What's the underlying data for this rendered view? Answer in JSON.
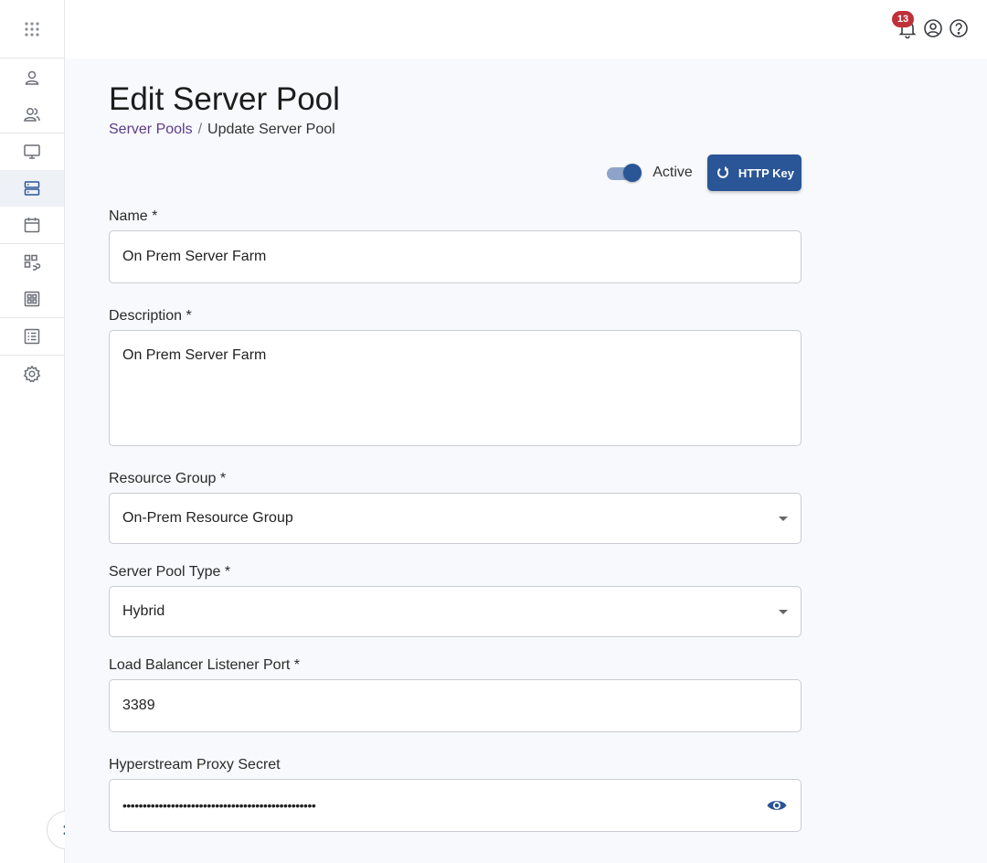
{
  "topbar": {
    "notification_count": "13"
  },
  "page": {
    "title": "Edit Server Pool",
    "breadcrumb": {
      "parent": "Server Pools",
      "separator": "/",
      "current": "Update Server Pool"
    }
  },
  "actions": {
    "toggle_label": "Active",
    "toggle_on": true,
    "http_key_label": "HTTP Key"
  },
  "form": {
    "name": {
      "label": "Name *",
      "value": "On Prem Server Farm"
    },
    "description": {
      "label": "Description *",
      "value": "On Prem Server Farm"
    },
    "resource_group": {
      "label": "Resource Group *",
      "value": "On-Prem Resource Group"
    },
    "server_pool_type": {
      "label": "Server Pool Type *",
      "value": "Hybrid"
    },
    "listener_port": {
      "label": "Load Balancer Listener Port *",
      "value": "3389"
    },
    "proxy_secret": {
      "label": "Hyperstream Proxy Secret",
      "value": "••••••••••••••••••••••••••••••••••••••••••••••••"
    }
  },
  "sidebar": {
    "icons": [
      "apps-grid-icon",
      "user-icon",
      "users-icon",
      "monitor-icon",
      "server-icon",
      "calendar-icon",
      "app-link-icon",
      "dashboard-icon",
      "list-icon",
      "gear-icon"
    ],
    "active": "server-icon"
  },
  "colors": {
    "primary": "#2a5596",
    "badge": "#c0303a",
    "link": "#5b3c88"
  }
}
